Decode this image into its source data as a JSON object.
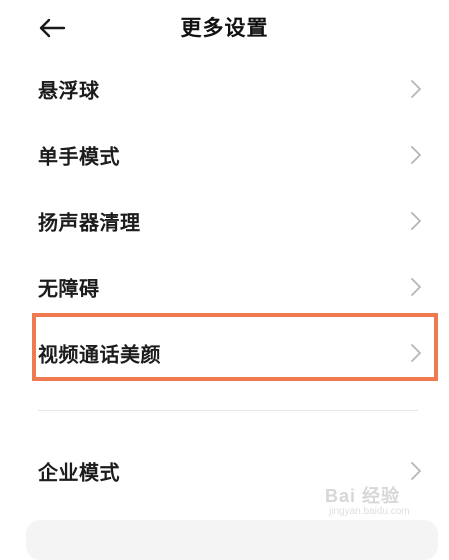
{
  "header": {
    "title": "更多设置",
    "back_icon": "arrow-left-icon"
  },
  "items": [
    {
      "label": "悬浮球"
    },
    {
      "label": "单手模式"
    },
    {
      "label": "扬声器清理"
    },
    {
      "label": "无障碍"
    },
    {
      "label": "视频通话美颜"
    },
    {
      "label": "企业模式"
    }
  ],
  "highlight_color": "#f07a4f",
  "watermark": {
    "text": "Bai 经验",
    "sub": "jingyan.baidu.com"
  }
}
